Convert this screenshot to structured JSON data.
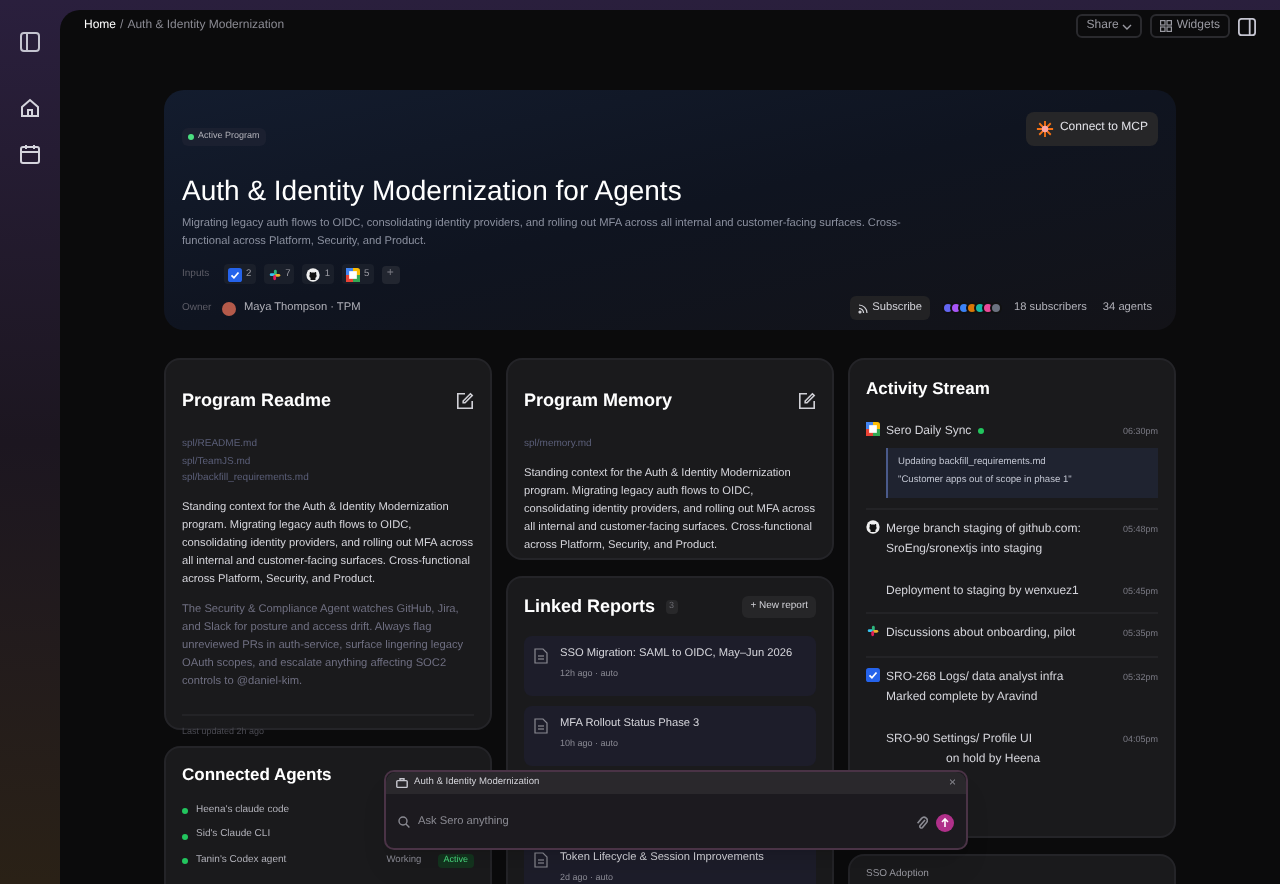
{
  "breadcrumb": {
    "home": "Home",
    "separator": "/",
    "current": "Auth & Identity Modernization"
  },
  "toolbar": {
    "share": "Share",
    "widgets": "Widgets"
  },
  "hero": {
    "badge": "Active Program",
    "title": "Auth & Identity Modernization for Agents",
    "description": "Migrating legacy auth flows to OIDC, consolidating identity providers, and rolling out MFA across all internal and customer-facing surfaces. Cross-functional across Platform, Security, and Product.",
    "connect": "Connect to MCP",
    "inputs_label": "Inputs",
    "inputs": [
      {
        "kind": "jira",
        "count": "2"
      },
      {
        "kind": "slack",
        "count": "7"
      },
      {
        "kind": "github",
        "count": "1"
      },
      {
        "kind": "calendar",
        "count": "5"
      }
    ],
    "add": "+",
    "owner_label": "Owner",
    "owner": "Maya Thompson · TPM",
    "subscribe": "Subscribe",
    "subscriber_avatars": [
      {
        "color": "#6366f1"
      },
      {
        "color": "#a855f7"
      },
      {
        "color": "#3b82f6"
      },
      {
        "color": "#d97706"
      },
      {
        "color": "#14b8a6"
      },
      {
        "color": "#ec4899"
      },
      {
        "color": "#6b7280"
      }
    ],
    "subscribers": "18 subscribers",
    "agents": "34 agents"
  },
  "readme": {
    "title": "Program Readme",
    "files": [
      "spl/README.md",
      "spl/TeamJS.md",
      "spl/backfill_requirements.md"
    ],
    "body": "Standing context for the Auth & Identity Modernization program. Migrating legacy auth flows to OIDC, consolidating identity providers, and rolling out MFA across all internal and customer-facing surfaces. Cross-functional across Platform, Security, and Product.",
    "note": "The Security & Compliance Agent watches GitHub, Jira, and Slack for posture and access drift. Always flag unreviewed PRs in auth-service, surface lingering legacy OAuth scopes, and escalate anything affecting SOC2 controls to @daniel-kim.",
    "updated": "Last updated 2h ago"
  },
  "memory": {
    "title": "Program Memory",
    "files": [
      "spl/memory.md"
    ],
    "body": "Standing context for the Auth & Identity Modernization program. Migrating legacy auth flows to OIDC, consolidating identity providers, and rolling out MFA across all internal and customer-facing surfaces. Cross-functional across Platform, Security, and Product."
  },
  "linked_reports": {
    "title": "Linked Reports",
    "count": "3",
    "new": "+ New report",
    "reports": [
      {
        "title": "SSO Migration: SAML to OIDC, May–Jun 2026",
        "meta": "12h ago · auto"
      },
      {
        "title": "MFA Rollout Status Phase 3",
        "meta": "10h ago · auto"
      },
      {
        "title": "Token Lifecycle & Session Improvements",
        "meta": "2d ago · auto"
      }
    ]
  },
  "connected_agents": {
    "title": "Connected Agents",
    "agents": [
      {
        "name": "Heena's claude code"
      },
      {
        "name": "Sid's Claude CLI"
      },
      {
        "name": "Tanin's Codex agent",
        "state": "Working",
        "badge": "Active"
      }
    ]
  },
  "activity": {
    "title": "Activity Stream",
    "items": [
      {
        "kind": "calendar",
        "title": "Sero Daily Sync",
        "live": true,
        "time": "06:30pm",
        "detail": [
          "Updating backfill_requirements.md",
          "\"Customer apps out of scope in phase 1\""
        ]
      },
      {
        "kind": "github",
        "title": "Merge branch staging of github.com: SroEng/sronextjs into staging",
        "live": false,
        "time": "05:48pm"
      },
      {
        "kind": "plain",
        "title": "Deployment to staging by wenxuez1",
        "live": false,
        "time": "05:45pm"
      },
      {
        "kind": "slack",
        "title": "Discussions about onboarding, pilot",
        "live": false,
        "time": "05:35pm"
      },
      {
        "kind": "jira",
        "title": "SRO-268 Logs/ data analyst infra Marked complete by Aravind",
        "live": false,
        "time": "05:32pm"
      },
      {
        "kind": "plain",
        "title": "SRO-90 Settings/ Profile UI",
        "title_end": "on hold by Heena",
        "live": false,
        "time": "04:05pm"
      }
    ]
  },
  "sso_adoption": {
    "title": "SSO Adoption"
  },
  "chat": {
    "context": "Auth & Identity Modernization",
    "close": "×",
    "placeholder": "Ask Sero anything"
  }
}
